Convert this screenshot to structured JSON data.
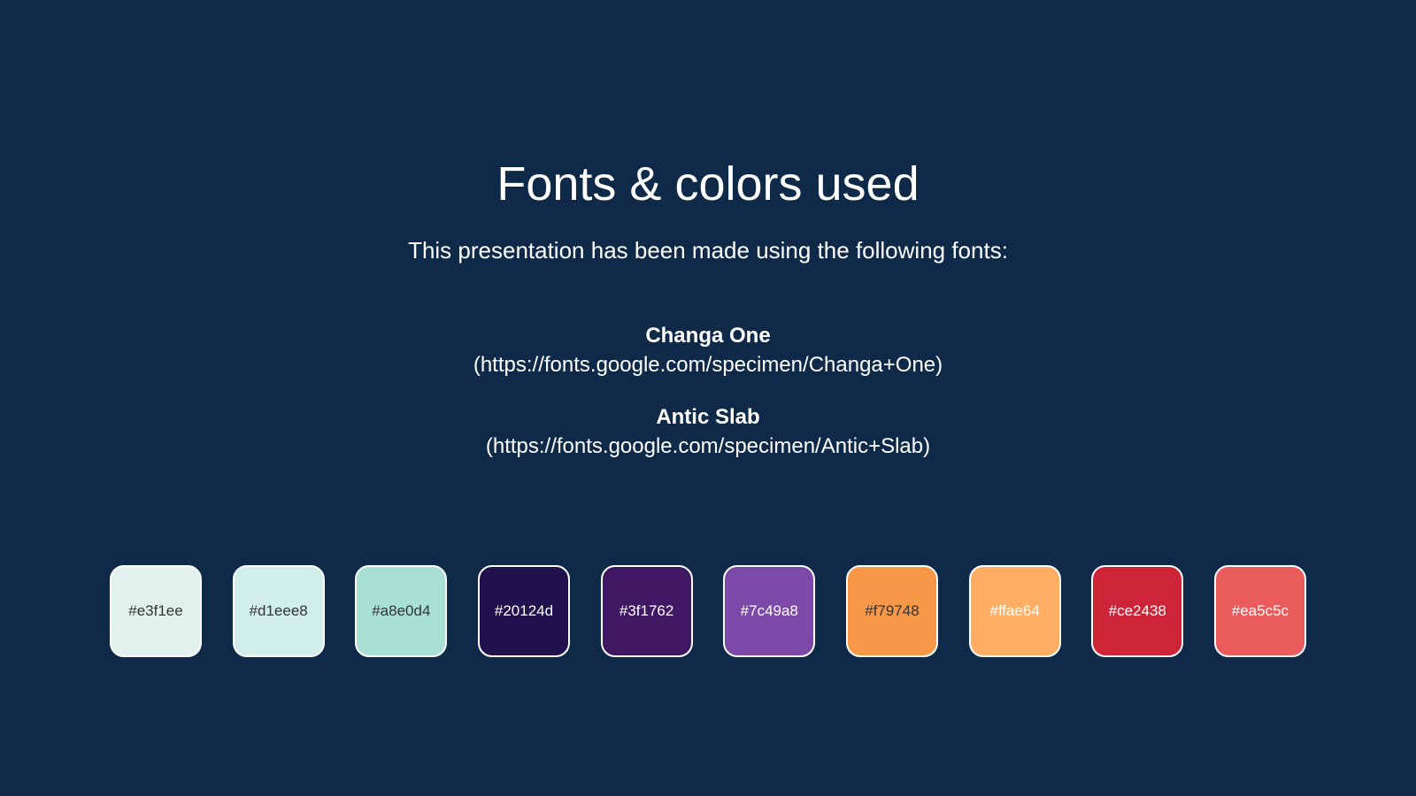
{
  "slide": {
    "title": "Fonts & colors used",
    "subtitle": "This presentation has been made using the following fonts:",
    "background_color": "#0f2a48"
  },
  "fonts": [
    {
      "name": "Changa One",
      "url": "(https://fonts.google.com/specimen/Changa+One)"
    },
    {
      "name": "Antic Slab",
      "url": "(https://fonts.google.com/specimen/Antic+Slab)"
    }
  ],
  "swatches": [
    {
      "label": "#e3f1ee",
      "color": "#e3f1ee",
      "text_color": "#333333"
    },
    {
      "label": "#d1eee8",
      "color": "#d1eee8",
      "text_color": "#333333"
    },
    {
      "label": "#a8e0d4",
      "color": "#a8e0d4",
      "text_color": "#333333"
    },
    {
      "label": "#20124d",
      "color": "#20124d",
      "text_color": "#ffffff"
    },
    {
      "label": "#3f1762",
      "color": "#3f1762",
      "text_color": "#ffffff"
    },
    {
      "label": "#7c49a8",
      "color": "#7c49a8",
      "text_color": "#ffffff"
    },
    {
      "label": "#f79748",
      "color": "#f79748",
      "text_color": "#333333"
    },
    {
      "label": "#ffae64",
      "color": "#ffae64",
      "text_color": "#ffffff"
    },
    {
      "label": "#ce2438",
      "color": "#ce2438",
      "text_color": "#ffffff"
    },
    {
      "label": "#ea5c5c",
      "color": "#ea5c5c",
      "text_color": "#ffffff"
    }
  ]
}
